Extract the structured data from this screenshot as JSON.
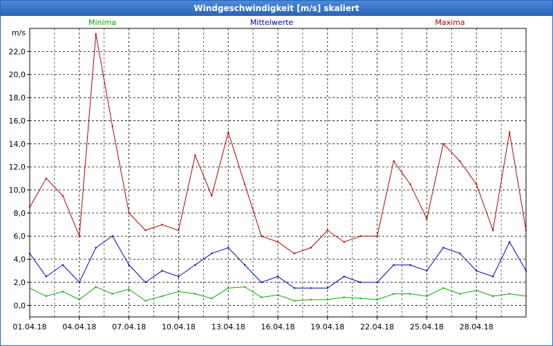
{
  "window": {
    "title": "Windgeschwindigkeit [m/s] skaliert"
  },
  "chart_data": {
    "type": "line",
    "title": "Windgeschwindigkeit [m/s] skaliert",
    "ylabel": "m/s",
    "xlabel": "",
    "ylim": [
      -1,
      24
    ],
    "yticks": [
      0,
      2,
      4,
      6,
      8,
      10,
      12,
      14,
      16,
      18,
      20,
      22
    ],
    "ytick_labels": [
      "0,0",
      "2,0",
      "4,0",
      "6,0",
      "8,0",
      "10,0",
      "12,0",
      "14,0",
      "16,0",
      "18,0",
      "20,0",
      "22,0"
    ],
    "xtick_labels": [
      "01.04.18",
      "04.04.18",
      "07.04.18",
      "10.04.18",
      "13.04.18",
      "16.04.18",
      "19.04.18",
      "22.04.18",
      "25.04.18",
      "28.04.18"
    ],
    "grid": true,
    "legend_position": "top",
    "x": [
      "01.04.18",
      "02.04.18",
      "03.04.18",
      "04.04.18",
      "05.04.18",
      "06.04.18",
      "07.04.18",
      "08.04.18",
      "09.04.18",
      "10.04.18",
      "11.04.18",
      "12.04.18",
      "13.04.18",
      "14.04.18",
      "15.04.18",
      "16.04.18",
      "17.04.18",
      "18.04.18",
      "19.04.18",
      "20.04.18",
      "21.04.18",
      "22.04.18",
      "23.04.18",
      "24.04.18",
      "25.04.18",
      "26.04.18",
      "27.04.18",
      "28.04.18",
      "29.04.18",
      "30.04.18",
      "01.05.18"
    ],
    "series": [
      {
        "name": "Minima",
        "color": "#00aa00",
        "values": [
          1.5,
          0.8,
          1.2,
          0.5,
          1.6,
          1.0,
          1.4,
          0.4,
          0.8,
          1.2,
          1.0,
          0.6,
          1.5,
          1.6,
          0.7,
          0.9,
          0.4,
          0.5,
          0.5,
          0.7,
          0.6,
          0.5,
          1.0,
          1.0,
          0.8,
          1.5,
          1.0,
          1.3,
          0.8,
          1.0,
          0.8
        ]
      },
      {
        "name": "Mittelwerte",
        "color": "#0000bb",
        "values": [
          4.5,
          2.5,
          3.5,
          2.0,
          5.0,
          6.0,
          3.5,
          2.0,
          3.0,
          2.5,
          3.5,
          4.5,
          5.0,
          3.5,
          2.0,
          2.5,
          1.5,
          1.5,
          1.5,
          2.5,
          2.0,
          2.0,
          3.5,
          3.5,
          3.0,
          5.0,
          4.5,
          3.0,
          2.5,
          5.5,
          3.0
        ]
      },
      {
        "name": "Maxima",
        "color": "#aa0000",
        "values": [
          8.5,
          11.0,
          9.5,
          6.0,
          23.5,
          15.5,
          8.0,
          6.5,
          7.0,
          6.5,
          13.0,
          9.5,
          15.0,
          10.5,
          6.0,
          5.5,
          4.5,
          5.0,
          6.5,
          5.5,
          6.0,
          6.0,
          12.5,
          10.5,
          7.5,
          14.0,
          12.5,
          10.5,
          6.5,
          15.0,
          6.5
        ]
      }
    ]
  }
}
